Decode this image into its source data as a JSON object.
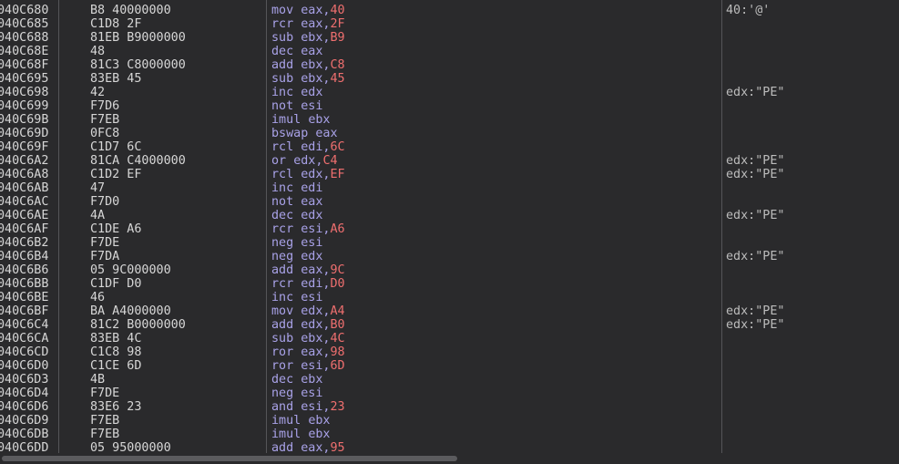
{
  "rows": [
    {
      "addr": "040C680",
      "bytes": "B8 40000000",
      "mn": "mov",
      "ops": "eax,",
      "imm": "40",
      "cmt": "40:'@'"
    },
    {
      "addr": "040C685",
      "bytes": "C1D8 2F",
      "mn": "rcr",
      "ops": "eax,",
      "imm": "2F",
      "cmt": ""
    },
    {
      "addr": "040C688",
      "bytes": "81EB B9000000",
      "mn": "sub",
      "ops": "ebx,",
      "imm": "B9",
      "cmt": ""
    },
    {
      "addr": "040C68E",
      "bytes": "48",
      "mn": "dec",
      "ops": "eax",
      "imm": "",
      "cmt": ""
    },
    {
      "addr": "040C68F",
      "bytes": "81C3 C8000000",
      "mn": "add",
      "ops": "ebx,",
      "imm": "C8",
      "cmt": ""
    },
    {
      "addr": "040C695",
      "bytes": "83EB 45",
      "mn": "sub",
      "ops": "ebx,",
      "imm": "45",
      "cmt": ""
    },
    {
      "addr": "040C698",
      "bytes": "42",
      "mn": "inc",
      "ops": "edx",
      "imm": "",
      "cmt": "edx:\"PE\""
    },
    {
      "addr": "040C699",
      "bytes": "F7D6",
      "mn": "not",
      "ops": "esi",
      "imm": "",
      "cmt": ""
    },
    {
      "addr": "040C69B",
      "bytes": "F7EB",
      "mn": "imul",
      "ops": "ebx",
      "imm": "",
      "cmt": ""
    },
    {
      "addr": "040C69D",
      "bytes": "0FC8",
      "mn": "bswap",
      "ops": "eax",
      "imm": "",
      "cmt": ""
    },
    {
      "addr": "040C69F",
      "bytes": "C1D7 6C",
      "mn": "rcl",
      "ops": "edi,",
      "imm": "6C",
      "cmt": ""
    },
    {
      "addr": "040C6A2",
      "bytes": "81CA C4000000",
      "mn": "or",
      "ops": "edx,",
      "imm": "C4",
      "cmt": "edx:\"PE\""
    },
    {
      "addr": "040C6A8",
      "bytes": "C1D2 EF",
      "mn": "rcl",
      "ops": "edx,",
      "imm": "EF",
      "cmt": "edx:\"PE\""
    },
    {
      "addr": "040C6AB",
      "bytes": "47",
      "mn": "inc",
      "ops": "edi",
      "imm": "",
      "cmt": ""
    },
    {
      "addr": "040C6AC",
      "bytes": "F7D0",
      "mn": "not",
      "ops": "eax",
      "imm": "",
      "cmt": ""
    },
    {
      "addr": "040C6AE",
      "bytes": "4A",
      "mn": "dec",
      "ops": "edx",
      "imm": "",
      "cmt": "edx:\"PE\""
    },
    {
      "addr": "040C6AF",
      "bytes": "C1DE A6",
      "mn": "rcr",
      "ops": "esi,",
      "imm": "A6",
      "cmt": ""
    },
    {
      "addr": "040C6B2",
      "bytes": "F7DE",
      "mn": "neg",
      "ops": "esi",
      "imm": "",
      "cmt": ""
    },
    {
      "addr": "040C6B4",
      "bytes": "F7DA",
      "mn": "neg",
      "ops": "edx",
      "imm": "",
      "cmt": "edx:\"PE\""
    },
    {
      "addr": "040C6B6",
      "bytes": "05 9C000000",
      "mn": "add",
      "ops": "eax,",
      "imm": "9C",
      "cmt": ""
    },
    {
      "addr": "040C6BB",
      "bytes": "C1DF D0",
      "mn": "rcr",
      "ops": "edi,",
      "imm": "D0",
      "cmt": ""
    },
    {
      "addr": "040C6BE",
      "bytes": "46",
      "mn": "inc",
      "ops": "esi",
      "imm": "",
      "cmt": ""
    },
    {
      "addr": "040C6BF",
      "bytes": "BA A4000000",
      "mn": "mov",
      "ops": "edx,",
      "imm": "A4",
      "cmt": "edx:\"PE\""
    },
    {
      "addr": "040C6C4",
      "bytes": "81C2 B0000000",
      "mn": "add",
      "ops": "edx,",
      "imm": "B0",
      "cmt": "edx:\"PE\""
    },
    {
      "addr": "040C6CA",
      "bytes": "83EB 4C",
      "mn": "sub",
      "ops": "ebx,",
      "imm": "4C",
      "cmt": ""
    },
    {
      "addr": "040C6CD",
      "bytes": "C1C8 98",
      "mn": "ror",
      "ops": "eax,",
      "imm": "98",
      "cmt": ""
    },
    {
      "addr": "040C6D0",
      "bytes": "C1CE 6D",
      "mn": "ror",
      "ops": "esi,",
      "imm": "6D",
      "cmt": ""
    },
    {
      "addr": "040C6D3",
      "bytes": "4B",
      "mn": "dec",
      "ops": "ebx",
      "imm": "",
      "cmt": ""
    },
    {
      "addr": "040C6D4",
      "bytes": "F7DE",
      "mn": "neg",
      "ops": "esi",
      "imm": "",
      "cmt": ""
    },
    {
      "addr": "040C6D6",
      "bytes": "83E6 23",
      "mn": "and",
      "ops": "esi,",
      "imm": "23",
      "cmt": ""
    },
    {
      "addr": "040C6D9",
      "bytes": "F7EB",
      "mn": "imul",
      "ops": "ebx",
      "imm": "",
      "cmt": ""
    },
    {
      "addr": "040C6DB",
      "bytes": "F7EB",
      "mn": "imul",
      "ops": "ebx",
      "imm": "",
      "cmt": ""
    },
    {
      "addr": "040C6DD",
      "bytes": "05 95000000",
      "mn": "add",
      "ops": "eax,",
      "imm": "95",
      "cmt": ""
    }
  ],
  "colors": {
    "background": "#2a2a2c",
    "text": "#d6d6d6",
    "mnemonic": "#a9a2e8",
    "immediate": "#ef6f6f",
    "comment": "#bcbcbc"
  }
}
